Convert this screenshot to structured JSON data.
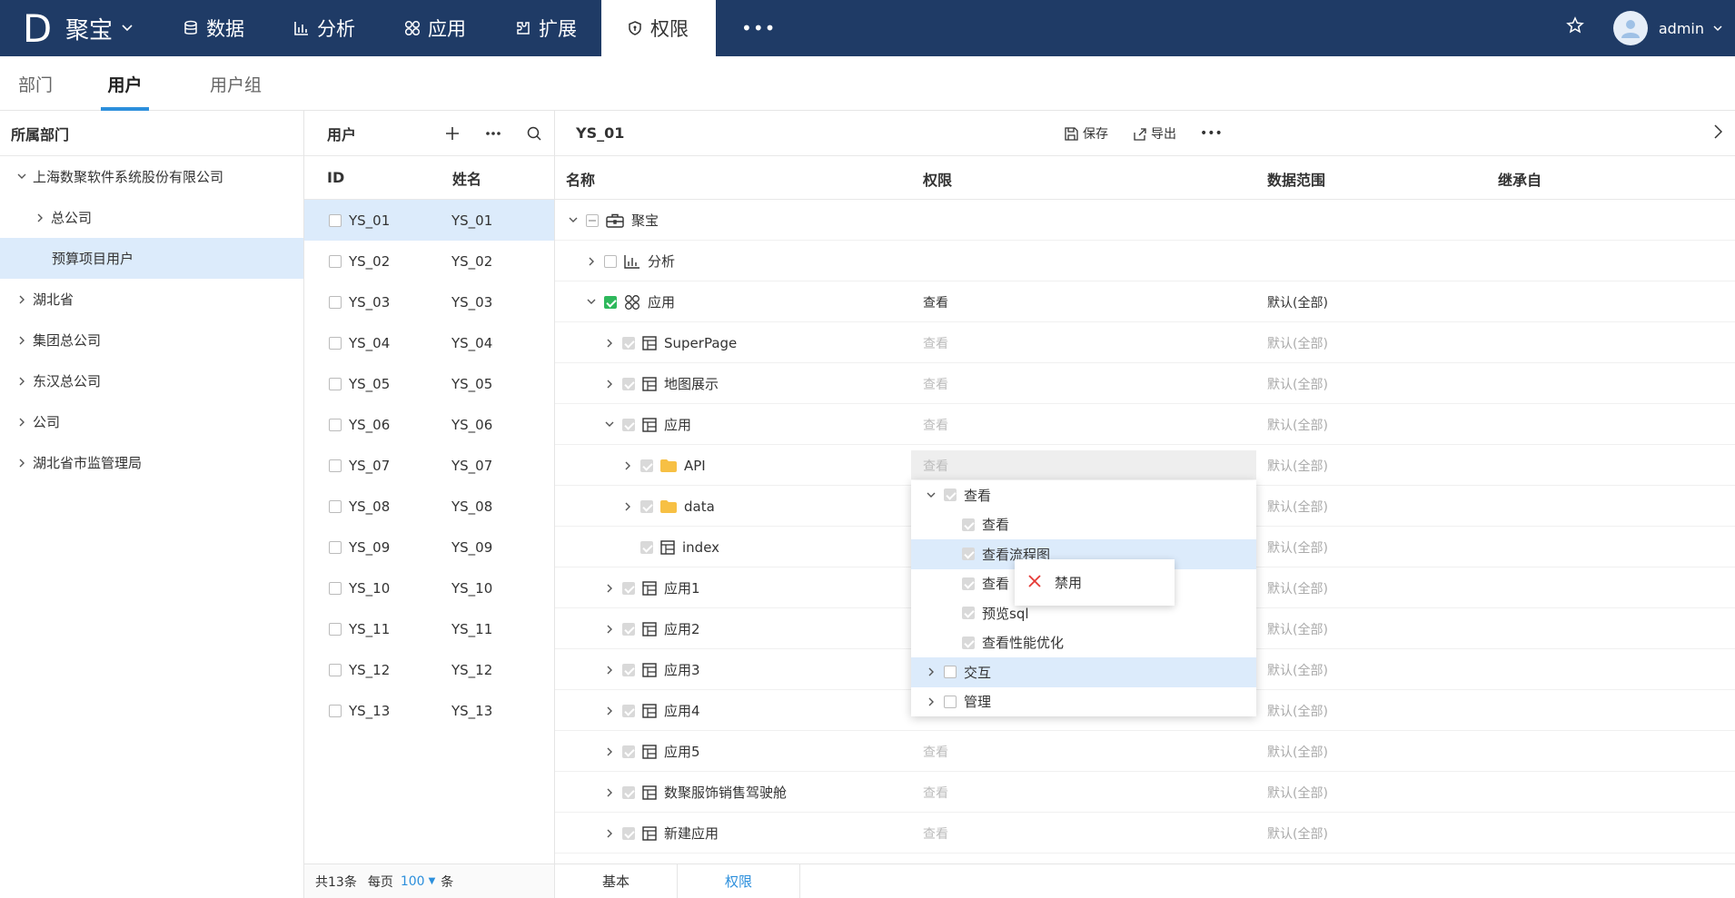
{
  "topbar": {
    "logo": "D",
    "brand": "聚宝",
    "nav": [
      {
        "label": "数据",
        "icon": "database-icon"
      },
      {
        "label": "分析",
        "icon": "bar-chart-icon"
      },
      {
        "label": "应用",
        "icon": "apps-icon"
      },
      {
        "label": "扩展",
        "icon": "puzzle-icon"
      }
    ],
    "active_nav": {
      "label": "权限",
      "icon": "shield-icon"
    },
    "more": "•••",
    "user": "admin"
  },
  "subtabs": [
    "部门",
    "用户",
    "用户组"
  ],
  "dept_panel": {
    "title": "所属部门",
    "items": [
      {
        "label": "上海数聚软件系统股份有限公司",
        "expanded": true
      },
      {
        "label": "总公司",
        "expanded": false
      },
      {
        "label": "预算项目用户"
      },
      {
        "label": "湖北省",
        "expanded": false
      },
      {
        "label": "集团总公司",
        "expanded": false
      },
      {
        "label": "东汉总公司",
        "expanded": false
      },
      {
        "label": "公司",
        "expanded": false
      },
      {
        "label": "湖北省市监管理局",
        "expanded": false
      }
    ]
  },
  "users_panel": {
    "title": "用户",
    "col_id": "ID",
    "col_name": "姓名",
    "rows": [
      {
        "id": "YS_01",
        "name": "YS_01"
      },
      {
        "id": "YS_02",
        "name": "YS_02"
      },
      {
        "id": "YS_03",
        "name": "YS_03"
      },
      {
        "id": "YS_04",
        "name": "YS_04"
      },
      {
        "id": "YS_05",
        "name": "YS_05"
      },
      {
        "id": "YS_06",
        "name": "YS_06"
      },
      {
        "id": "YS_07",
        "name": "YS_07"
      },
      {
        "id": "YS_08",
        "name": "YS_08"
      },
      {
        "id": "YS_09",
        "name": "YS_09"
      },
      {
        "id": "YS_10",
        "name": "YS_10"
      },
      {
        "id": "YS_11",
        "name": "YS_11"
      },
      {
        "id": "YS_12",
        "name": "YS_12"
      },
      {
        "id": "YS_13",
        "name": "YS_13"
      }
    ],
    "footer": {
      "total": "共13条",
      "per_page": "每页",
      "size": "100",
      "unit": "条"
    }
  },
  "perm_panel": {
    "title": "YS_01",
    "save": "保存",
    "export": "导出",
    "more": "•••",
    "columns": {
      "name": "名称",
      "perm": "权限",
      "scope": "数据范围",
      "inherit": "继承自"
    },
    "rows": [
      {
        "label": "聚宝",
        "arrow": "down",
        "check": "partial",
        "icon": "briefcase-icon",
        "perm": "",
        "scope": ""
      },
      {
        "label": "分析",
        "arrow": "right",
        "check": "empty",
        "icon": "bar-chart-icon",
        "perm": "",
        "scope": ""
      },
      {
        "label": "应用",
        "arrow": "down",
        "check": "green",
        "icon": "apps-icon",
        "perm": "查看",
        "scope": "默认(全部)"
      },
      {
        "label": "SuperPage",
        "arrow": "right",
        "check": "gray",
        "icon": "page-icon",
        "perm": "查看",
        "scope": "默认(全部)"
      },
      {
        "label": "地图展示",
        "arrow": "right",
        "check": "gray",
        "icon": "page-icon",
        "perm": "查看",
        "scope": "默认(全部)"
      },
      {
        "label": "应用",
        "arrow": "down",
        "check": "gray",
        "icon": "page-icon",
        "perm": "查看",
        "scope": "默认(全部)"
      },
      {
        "label": "API",
        "arrow": "right",
        "check": "gray",
        "icon": "folder-icon",
        "perm": "查看",
        "scope": "默认(全部)"
      },
      {
        "label": "data",
        "arrow": "right",
        "check": "gray",
        "icon": "folder-icon",
        "perm": "",
        "scope": "默认(全部)"
      },
      {
        "label": "index",
        "arrow": "",
        "check": "gray",
        "icon": "page-icon",
        "perm": "",
        "scope": "默认(全部)"
      },
      {
        "label": "应用1",
        "arrow": "right",
        "check": "gray",
        "icon": "page-icon",
        "perm": "",
        "scope": "默认(全部)"
      },
      {
        "label": "应用2",
        "arrow": "right",
        "check": "gray",
        "icon": "page-icon",
        "perm": "",
        "scope": "默认(全部)"
      },
      {
        "label": "应用3",
        "arrow": "right",
        "check": "gray",
        "icon": "page-icon",
        "perm": "",
        "scope": "默认(全部)"
      },
      {
        "label": "应用4",
        "arrow": "right",
        "check": "gray",
        "icon": "page-icon",
        "perm": "",
        "scope": "默认(全部)"
      },
      {
        "label": "应用5",
        "arrow": "right",
        "check": "gray",
        "icon": "page-icon",
        "perm": "查看",
        "scope": "默认(全部)"
      },
      {
        "label": "数聚服饰销售驾驶舱",
        "arrow": "right",
        "check": "gray",
        "icon": "page-icon",
        "perm": "查看",
        "scope": "默认(全部)"
      },
      {
        "label": "新建应用",
        "arrow": "right",
        "check": "gray",
        "icon": "page-icon",
        "perm": "查看",
        "scope": "默认(全部)"
      }
    ],
    "popup": [
      {
        "label": "查看",
        "arrow": "down",
        "check": "gray"
      },
      {
        "label": "查看",
        "arrow": "",
        "check": "gray"
      },
      {
        "label": "查看流程图",
        "arrow": "",
        "check": "gray",
        "highlight": true
      },
      {
        "label": "查看",
        "arrow": "",
        "check": "gray"
      },
      {
        "label": "预览sql",
        "arrow": "",
        "check": "gray"
      },
      {
        "label": "查看性能优化",
        "arrow": "",
        "check": "gray"
      },
      {
        "label": "交互",
        "arrow": "right",
        "check": "empty",
        "highlight": true
      },
      {
        "label": "管理",
        "arrow": "right",
        "check": "empty"
      }
    ],
    "context_menu": {
      "label": "禁用"
    },
    "bottom_tabs": [
      "基本",
      "权限"
    ]
  }
}
